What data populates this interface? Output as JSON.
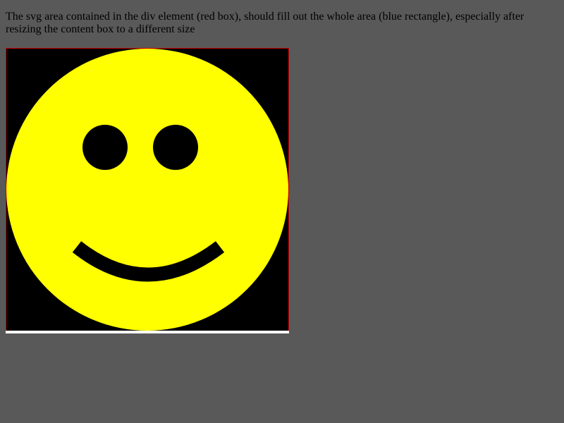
{
  "description": "The svg area contained in the div element (red box), should fill out the whole area (blue rectangle), especially after resizing the content box to a different size",
  "illustration": {
    "subject": "smiley-face",
    "background_color": "#000000",
    "face_color": "#ffff00",
    "feature_color": "#000000",
    "border_color": "#cc0000"
  }
}
